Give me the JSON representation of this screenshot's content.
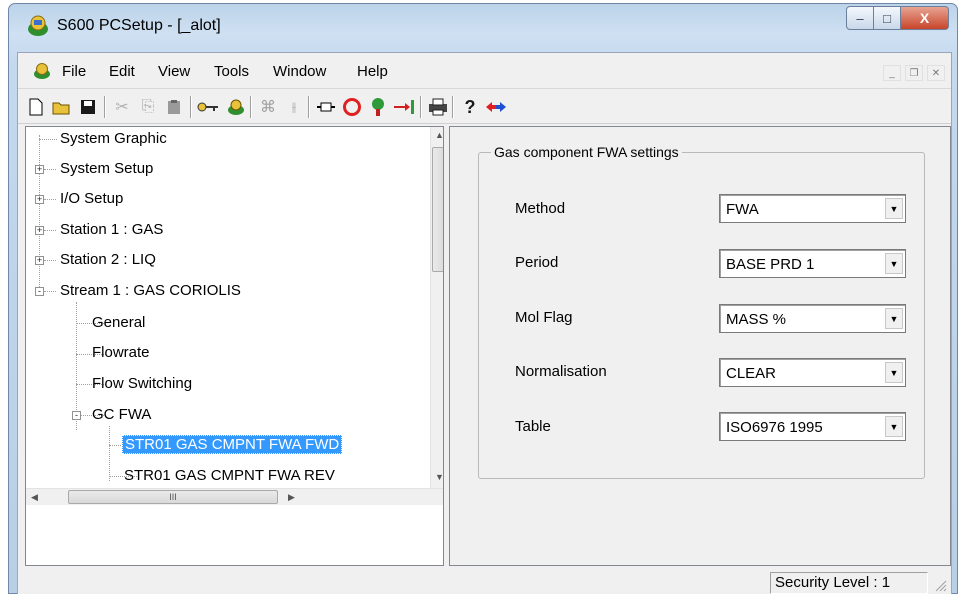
{
  "window": {
    "title": "S600 PCSetup - [_alot]",
    "buttons": {
      "minimize": "–",
      "maximize": "□",
      "close": "X"
    }
  },
  "menubar": {
    "items": [
      "File",
      "Edit",
      "View",
      "Tools",
      "Window",
      "Help"
    ]
  },
  "toolbar": {
    "icons": [
      "new-icon",
      "open-icon",
      "save-icon",
      "cut-icon",
      "copy-icon",
      "paste-icon",
      "key-icon",
      "connect-icon",
      "network-icon",
      "io-icon",
      "module-icon",
      "stop-icon",
      "station-icon",
      "download-icon",
      "print-icon",
      "help-icon",
      "context-help-icon"
    ]
  },
  "tree": {
    "items": [
      {
        "label": "System Graphic",
        "expander": ""
      },
      {
        "label": "System Setup",
        "expander": "+"
      },
      {
        "label": "I/O Setup",
        "expander": "+"
      },
      {
        "label": "Station 1 : GAS",
        "expander": "+"
      },
      {
        "label": "Station 2 : LIQ",
        "expander": "+"
      },
      {
        "label": "Stream 1 : GAS CORIOLIS",
        "expander": "-"
      },
      {
        "label": "General",
        "expander": ""
      },
      {
        "label": "Flowrate",
        "expander": ""
      },
      {
        "label": "Flow Switching",
        "expander": ""
      },
      {
        "label": "GC FWA",
        "expander": "-"
      },
      {
        "label": "STR01 GAS CMPNT FWA FWD",
        "expander": ""
      },
      {
        "label": "STR01 GAS CMPNT FWA REV",
        "expander": ""
      }
    ],
    "hscroll_thumb": "III"
  },
  "settings": {
    "group_title": "Gas component FWA settings",
    "fields": [
      {
        "label": "Method",
        "value": "FWA"
      },
      {
        "label": "Period",
        "value": "BASE PRD 1"
      },
      {
        "label": "Mol Flag",
        "value": "MASS %"
      },
      {
        "label": "Normalisation",
        "value": "CLEAR"
      },
      {
        "label": "Table",
        "value": "ISO6976 1995"
      }
    ]
  },
  "statusbar": {
    "security": "Security Level : 1"
  }
}
